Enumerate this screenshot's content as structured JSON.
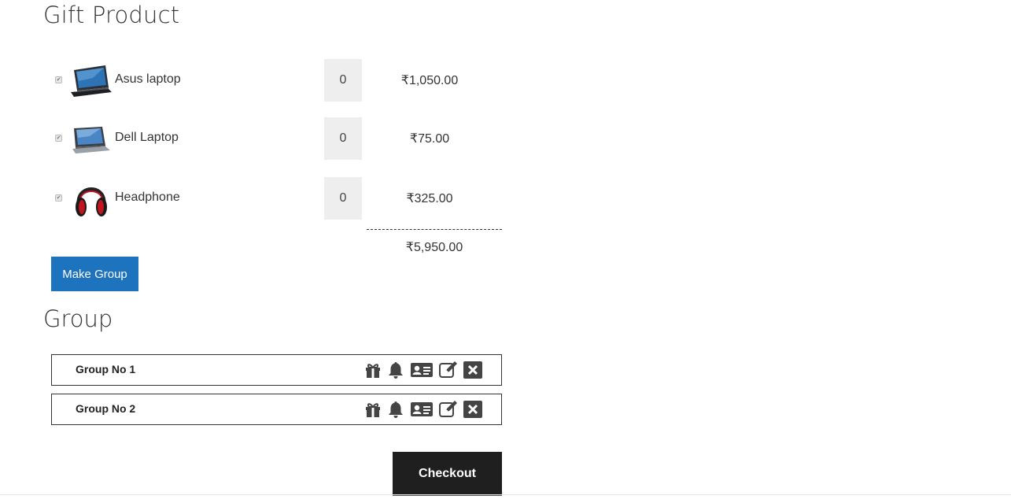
{
  "gift_section": {
    "title": "Gift Product",
    "products": [
      {
        "name": "Asus laptop",
        "qty": "0",
        "price": "₹1,050.00",
        "checked": true,
        "image": "laptop-asus-image"
      },
      {
        "name": "Dell Laptop",
        "qty": "0",
        "price": "₹75.00",
        "checked": true,
        "image": "laptop-dell-image"
      },
      {
        "name": "Headphone",
        "qty": "0",
        "price": "₹325.00",
        "checked": true,
        "image": "headphone-image"
      }
    ],
    "total": "₹5,950.00",
    "make_group_label": "Make Group"
  },
  "group_section": {
    "title": "Group",
    "groups": [
      {
        "name": "Group No 1",
        "icons": [
          "gift-icon",
          "bell-icon",
          "id-card-icon",
          "edit-icon",
          "close-icon"
        ]
      },
      {
        "name": "Group No 2",
        "icons": [
          "gift-icon",
          "bell-icon",
          "id-card-icon",
          "edit-icon",
          "close-icon"
        ]
      }
    ]
  },
  "checkout_label": "Checkout",
  "colors": {
    "primary_button": "#1e73be",
    "checkout_button": "#1f1f1f",
    "qty_background": "#eeeeee",
    "icon": "#444444"
  }
}
